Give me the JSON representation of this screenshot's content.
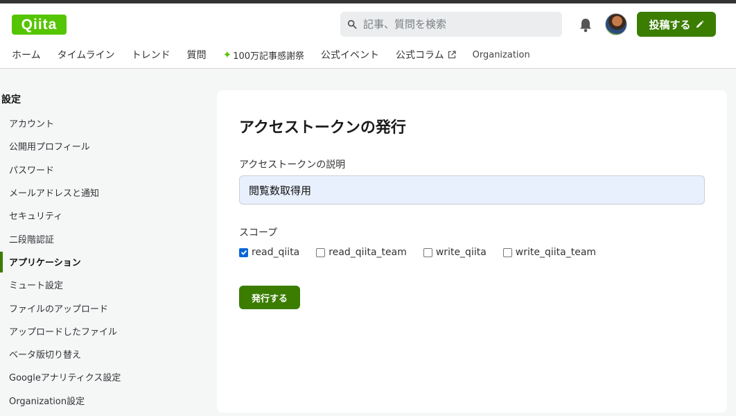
{
  "header": {
    "logo_text": "Qiita",
    "search_placeholder": "記事、質問を検索",
    "post_button_label": "投稿する",
    "nav": [
      {
        "label": "ホーム"
      },
      {
        "label": "タイムライン"
      },
      {
        "label": "トレンド"
      },
      {
        "label": "質問"
      },
      {
        "label": "100万記事感謝祭",
        "icon": "sparkle-icon"
      },
      {
        "label": "公式イベント"
      },
      {
        "label": "公式コラム",
        "icon": "external-link-icon"
      },
      {
        "label": "Organization"
      }
    ]
  },
  "sidebar": {
    "title": "設定",
    "items": [
      {
        "label": "アカウント"
      },
      {
        "label": "公開用プロフィール"
      },
      {
        "label": "パスワード"
      },
      {
        "label": "メールアドレスと通知"
      },
      {
        "label": "セキュリティ"
      },
      {
        "label": "二段階認証"
      },
      {
        "label": "アプリケーション",
        "active": true
      },
      {
        "label": "ミュート設定"
      },
      {
        "label": "ファイルのアップロード"
      },
      {
        "label": "アップロードしたファイル"
      },
      {
        "label": "ベータ版切り替え"
      },
      {
        "label": "Googleアナリティクス設定"
      },
      {
        "label": "Organization設定"
      }
    ]
  },
  "main": {
    "title": "アクセストークンの発行",
    "description_label": "アクセストークンの説明",
    "description_value": "閲覧数取得用",
    "scope_label": "スコープ",
    "scopes": [
      {
        "label": "read_qiita",
        "checked": true
      },
      {
        "label": "read_qiita_team",
        "checked": false
      },
      {
        "label": "write_qiita",
        "checked": false
      },
      {
        "label": "write_qiita_team",
        "checked": false
      }
    ],
    "submit_label": "発行する"
  },
  "colors": {
    "brand": "#55c500",
    "primary_button": "#3a7d00",
    "checkbox_checked": "#0a66d8"
  }
}
